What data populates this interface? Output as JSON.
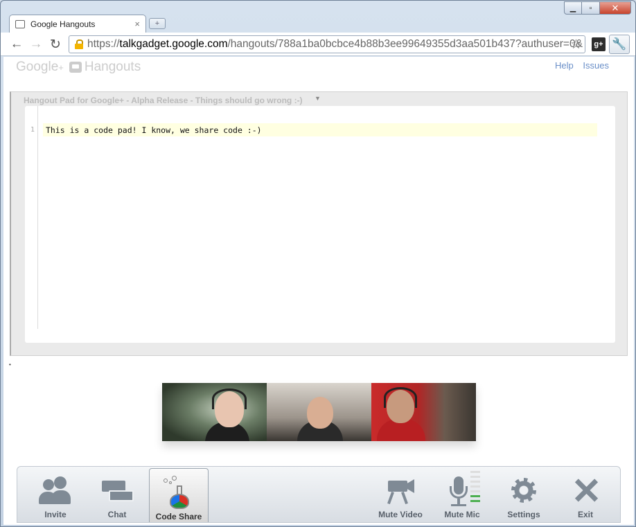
{
  "browser": {
    "tab_title": "Google Hangouts",
    "url_scheme": "https://",
    "url_host": "talkgadget.google.com",
    "url_path": "/hangouts/788a1ba0bcbce4b88b3ee99649355d3aa501b437?authuser=0&",
    "extension_label": "g+",
    "tab_close_glyph": "×",
    "newtab_glyph": "+",
    "minimize_glyph": "▁",
    "maximize_glyph": "▫",
    "close_glyph": "✕"
  },
  "header": {
    "brand_google": "Google",
    "brand_plus": "+",
    "brand_hangouts": "Hangouts",
    "help_link": "Help",
    "issues_link": "Issues"
  },
  "pad": {
    "title": "Hangout Pad for Google+ - Alpha Release - Things should go wrong :-)",
    "line_number": "1",
    "code": "This is a code pad! I know, we share code :-)"
  },
  "toolbar": {
    "invite": "Invite",
    "chat": "Chat",
    "code_share": "Code Share",
    "mute_video": "Mute Video",
    "mute_mic": "Mute Mic",
    "settings": "Settings",
    "exit": "Exit"
  },
  "colors": {
    "accent_link": "#6a8fc8",
    "code_highlight": "#ffffe1",
    "toolbar_icon": "#7f8a95"
  }
}
